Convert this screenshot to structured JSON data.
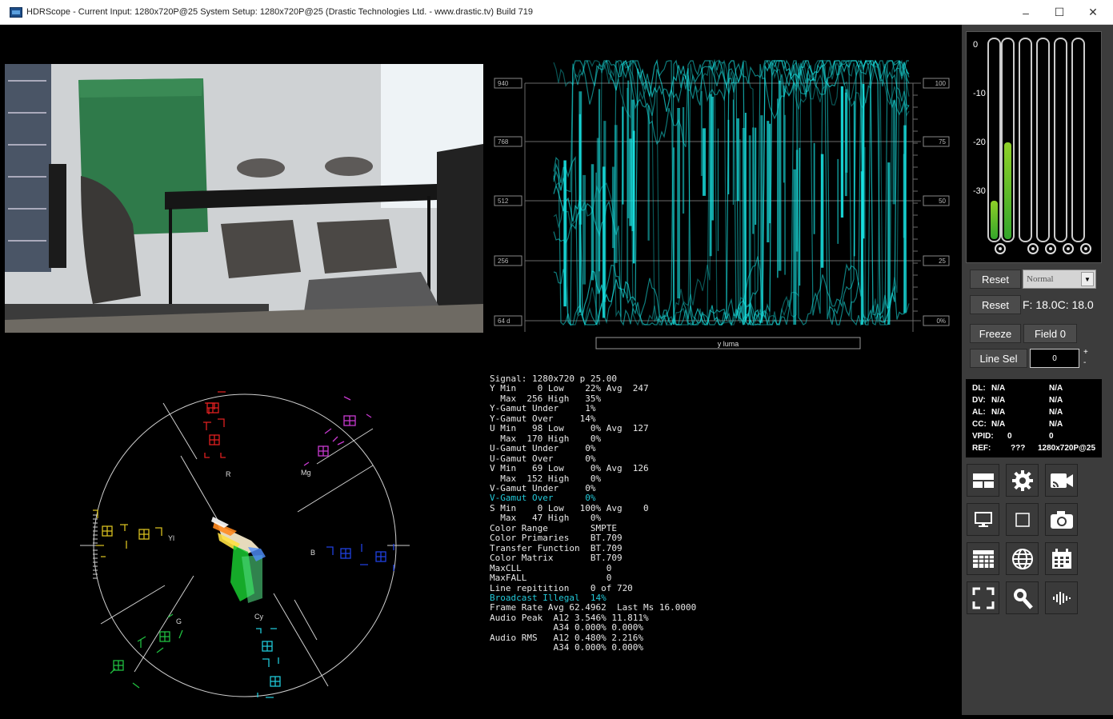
{
  "window": {
    "title": "HDRScope -  Current Input: 1280x720P@25   System Setup: 1280x720P@25     (Drastic Technologies Ltd. - www.drastic.tv) Build 719",
    "minimize": "–",
    "maximize": "☐",
    "close": "✕"
  },
  "waveform": {
    "left_scale": [
      "940",
      "768",
      "512",
      "256",
      "64 d"
    ],
    "right_scale": [
      "100",
      "75",
      "50",
      "25",
      "0%"
    ],
    "mode_label": "y luma",
    "trace_color": "#19e6e6"
  },
  "vectorscope": {
    "labels": [
      "R",
      "Mg",
      "Yl",
      "B",
      "G",
      "Cy"
    ]
  },
  "stats": {
    "lines": [
      "Signal: 1280x720 p 25.00",
      "Y Min    0 Low    22% Avg  247",
      "  Max  256 High   35%",
      "Y-Gamut Under     1%",
      "Y-Gamut Over     14%",
      "U Min   98 Low     0% Avg  127",
      "  Max  170 High    0%",
      "U-Gamut Under     0%",
      "U-Gamut Over      0%",
      "V Min   69 Low     0% Avg  126",
      "  Max  152 High    0%",
      "V-Gamut Under     0%",
      "V-Gamut Over      0%",
      "S Min    0 Low   100% Avg    0",
      "  Max   47 High    0%",
      "Color Range        SMPTE",
      "Color Primaries    BT.709",
      "Transfer Function  BT.709",
      "Color Matrix       BT.709",
      "MaxCLL                0",
      "MaxFALL               0",
      "Line repitition    0 of 720",
      "Broadcast Illegal  14%",
      "Frame Rate Avg 62.4962  Last Ms 16.0000",
      "Audio Peak  A12 3.546% 11.811%",
      "            A34 0.000% 0.000%",
      "Audio RMS   A12 0.480% 2.216%",
      "            A34 0.000% 0.000%"
    ],
    "highlighted": [
      12,
      22
    ]
  },
  "audio": {
    "db_labels": [
      "0",
      "-10",
      "-20",
      "-30"
    ],
    "levels": [
      0.19,
      0.48,
      0,
      0,
      0,
      0
    ]
  },
  "controls": {
    "reset1": "Reset",
    "reset2": "Reset",
    "mode_value": "Normal",
    "fc_text": "F: 18.0C: 18.0",
    "freeze": "Freeze",
    "field": "Field 0",
    "line_sel": "Line Sel",
    "line_value": "0",
    "plus": "+",
    "minus": "-"
  },
  "info": [
    {
      "k": "DL:",
      "a": "N/A",
      "b": "N/A"
    },
    {
      "k": "DV:",
      "a": "N/A",
      "b": "N/A"
    },
    {
      "k": "AL:",
      "a": "N/A",
      "b": "N/A"
    },
    {
      "k": "CC:",
      "a": "N/A",
      "b": "N/A"
    },
    {
      "k": "VPID:",
      "a": "0",
      "b": "0"
    },
    {
      "k": "REF:",
      "a": "???",
      "b": "1280x720P@25"
    }
  ],
  "toolbar_icons": [
    "layout-icon",
    "settings-gear-icon",
    "cast-camera-icon",
    "monitor-icon",
    "square-icon",
    "snapshot-camera-icon",
    "table-icon",
    "globe-icon",
    "calendar-icon",
    "fullscreen-icon",
    "magnify-icon",
    "audio-waveform-icon"
  ]
}
